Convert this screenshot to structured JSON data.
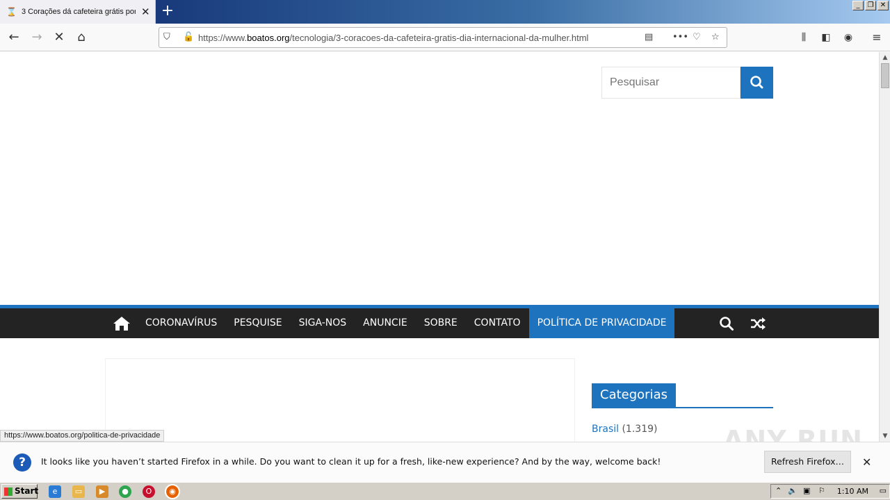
{
  "browser": {
    "tab_title": "3 Corações dá cafeteira grátis por",
    "url_prefix": "https://www.",
    "url_domain": "boatos.org",
    "url_path": "/tecnologia/3-coracoes-da-cafeteira-gratis-dia-internacional-da-mulher.html",
    "status_url": "https://www.boatos.org/politica-de-privacidade"
  },
  "site": {
    "search_placeholder": "Pesquisar",
    "menu": [
      {
        "label": "CORONAVÍRUS"
      },
      {
        "label": "PESQUISE"
      },
      {
        "label": "SIGA-NOS"
      },
      {
        "label": "ANUNCIE"
      },
      {
        "label": "SOBRE"
      },
      {
        "label": "CONTATO"
      },
      {
        "label": "POLÍTICA DE PRIVACIDADE",
        "active": true
      }
    ],
    "categories_title": "Categorias",
    "category_first": {
      "name": "Brasil",
      "count": "(1.319)"
    }
  },
  "notification": {
    "message": "It looks like you haven’t started Firefox in a while. Do you want to clean it up for a fresh, like-new experience? And by the way, welcome back!",
    "button": "Refresh Firefox…"
  },
  "watermark": "ANY RUN",
  "taskbar": {
    "start_label": "Start",
    "clock": "1:10 AM"
  },
  "colors": {
    "accent": "#1e73be",
    "menu_bg": "#232323"
  }
}
